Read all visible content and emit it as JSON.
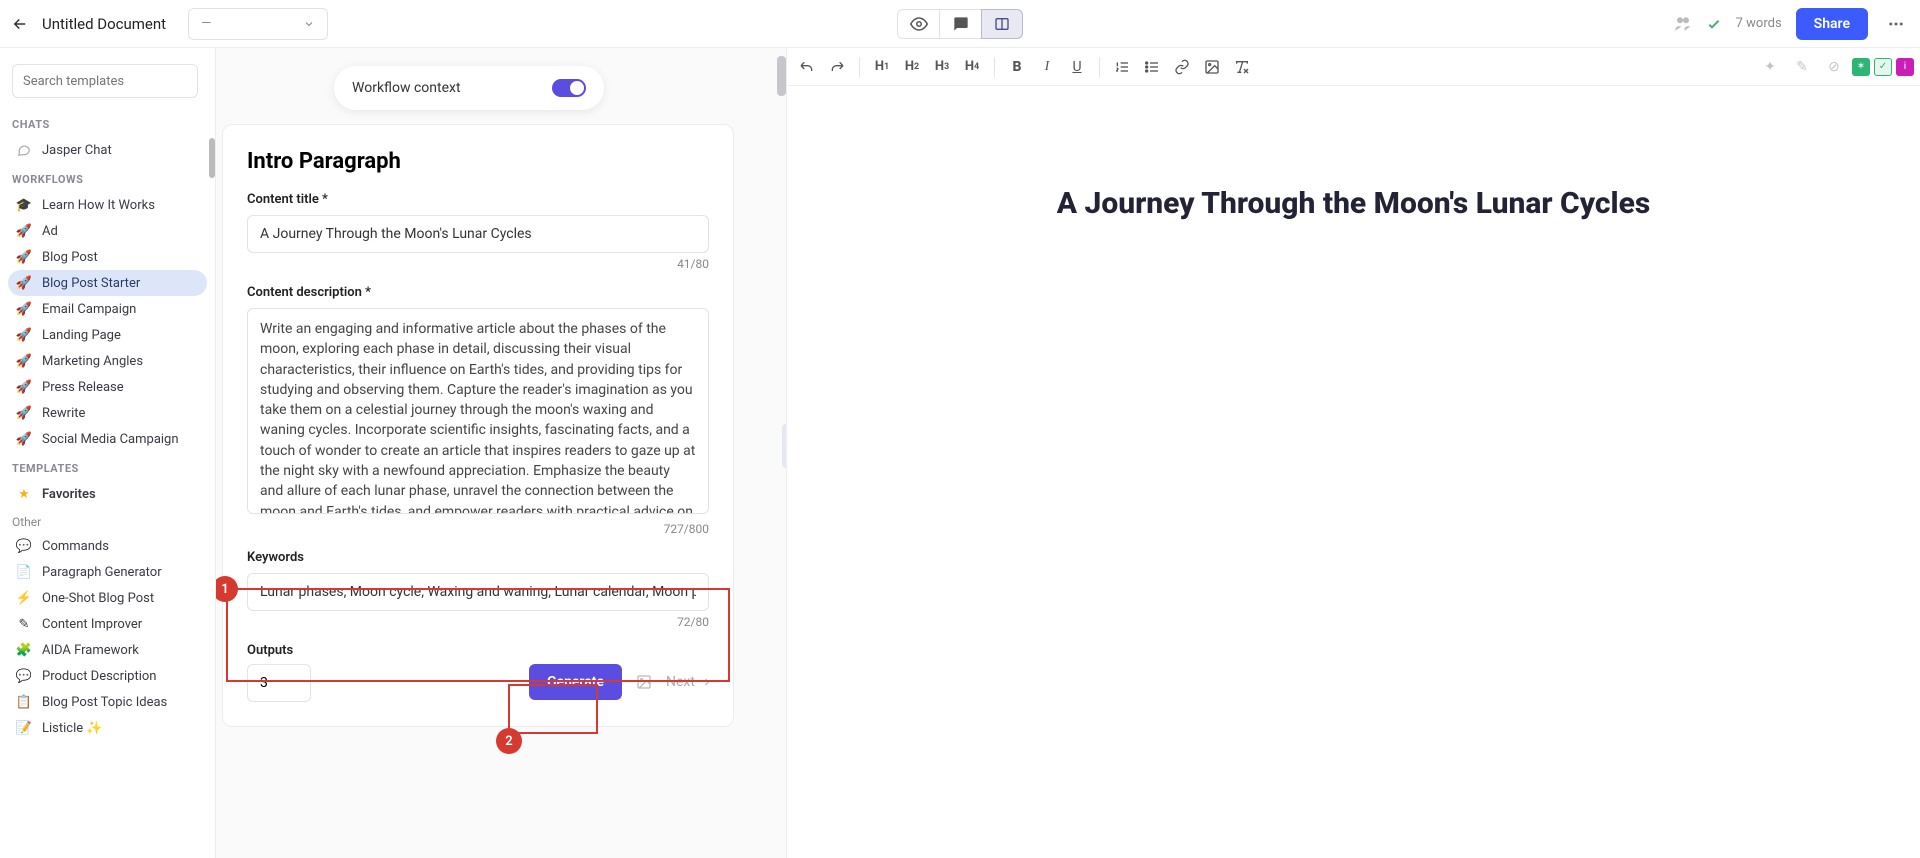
{
  "header": {
    "doc_title": "Untitled Document",
    "dropdown_label": "—",
    "word_count": "7 words",
    "share_label": "Share"
  },
  "sidebar": {
    "search_placeholder": "Search templates",
    "sections": {
      "chats": "CHATS",
      "workflows": "WORKFLOWS",
      "templates": "TEMPLATES",
      "other": "Other"
    },
    "chats": [
      {
        "label": "Jasper Chat"
      }
    ],
    "workflows": [
      {
        "label": "Learn How It Works"
      },
      {
        "label": "Ad"
      },
      {
        "label": "Blog Post"
      },
      {
        "label": "Blog Post Starter",
        "active": true
      },
      {
        "label": "Email Campaign"
      },
      {
        "label": "Landing Page"
      },
      {
        "label": "Marketing Angles"
      },
      {
        "label": "Press Release"
      },
      {
        "label": "Rewrite"
      },
      {
        "label": "Social Media Campaign"
      }
    ],
    "favorites_label": "Favorites",
    "templates": [
      {
        "label": "Commands"
      },
      {
        "label": "Paragraph Generator"
      },
      {
        "label": "One-Shot Blog Post"
      },
      {
        "label": "Content Improver"
      },
      {
        "label": "AIDA Framework"
      },
      {
        "label": "Product Description"
      },
      {
        "label": "Blog Post Topic Ideas"
      },
      {
        "label": "Listicle ✨"
      }
    ]
  },
  "workflow": {
    "context_label": "Workflow context",
    "card_title": "Intro Paragraph",
    "content_title_label": "Content title *",
    "content_title_value": "A Journey Through the Moon's Lunar Cycles",
    "content_title_counter": "41/80",
    "content_desc_label": "Content description *",
    "content_desc_value": "Write an engaging and informative article about the phases of the moon, exploring each phase in detail, discussing their visual characteristics, their influence on Earth's tides, and providing tips for studying and observing them. Capture the reader's imagination as you take them on a celestial journey through the moon's waxing and waning cycles. Incorporate scientific insights, fascinating facts, and a touch of wonder to create an article that inspires readers to gaze up at the night sky with a newfound appreciation. Emphasize the beauty and allure of each lunar phase, unravel the connection between the moon and Earth's tides, and empower readers with practical advice on how to embark on their own lunar exploration.",
    "content_desc_counter": "727/800",
    "keywords_label": "Keywords",
    "keywords_value": "Lunar phases, Moon cycle, Waxing and waning, Lunar calendar, Moon phases",
    "keywords_counter": "72/80",
    "outputs_label": "Outputs",
    "outputs_value": "3",
    "generate_label": "Generate",
    "next_label": "Next",
    "annotations": {
      "badge1": "1",
      "badge2": "2"
    }
  },
  "editor": {
    "heading": "A Journey Through the Moon's Lunar Cycles"
  }
}
